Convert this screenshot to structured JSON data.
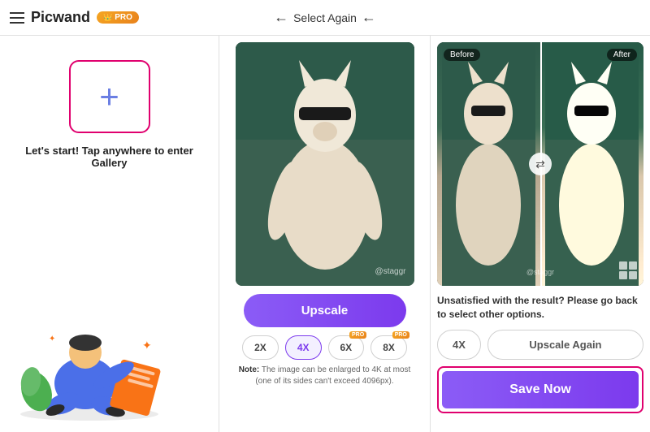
{
  "header": {
    "app_name": "Picwand",
    "pro_label": "PRO",
    "select_again": "Select Again"
  },
  "left_panel": {
    "gallery_hint": "Let's start! Tap anywhere to enter Gallery"
  },
  "middle_panel": {
    "watermark": "@staggr",
    "upscale_btn": "Upscale",
    "scale_options": [
      {
        "label": "2X",
        "active": false,
        "pro": false
      },
      {
        "label": "4X",
        "active": true,
        "pro": false
      },
      {
        "label": "6X",
        "active": false,
        "pro": true
      },
      {
        "label": "8X",
        "active": false,
        "pro": true
      }
    ],
    "note_label": "Note:",
    "note_text": " The image can be enlarged to 4K at most (one of its sides can't exceed 4096px)."
  },
  "right_panel": {
    "before_label": "Before",
    "after_label": "After",
    "watermark": "@staggr",
    "unsatisfied_text": "Unsatisfied with the result? Please go back to select other options.",
    "scale_4x_label": "4X",
    "upscale_again_label": "Upscale Again",
    "save_now_label": "Save Now"
  }
}
